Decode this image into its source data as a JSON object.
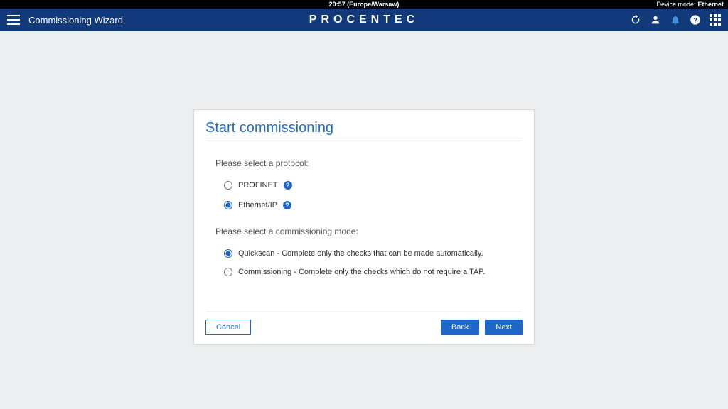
{
  "topbar": {
    "time": "20:57 (Europe/Warsaw)",
    "device_mode_label": "Device mode:",
    "device_mode_value": "Ethernet"
  },
  "navbar": {
    "title": "Commissioning Wizard",
    "brand": "PROCENTEC"
  },
  "card": {
    "heading": "Start commissioning",
    "protocol_label": "Please select a protocol:",
    "protocols": [
      {
        "label": "PROFINET",
        "selected": false
      },
      {
        "label": "Ethernet/IP",
        "selected": true
      }
    ],
    "mode_label": "Please select a commissioning mode:",
    "modes": [
      {
        "label": "Quickscan - Complete only the checks that can be made automatically.",
        "selected": true
      },
      {
        "label": "Commissioning - Complete only the checks which do not require a TAP.",
        "selected": false
      }
    ],
    "buttons": {
      "cancel": "Cancel",
      "back": "Back",
      "next": "Next"
    }
  }
}
